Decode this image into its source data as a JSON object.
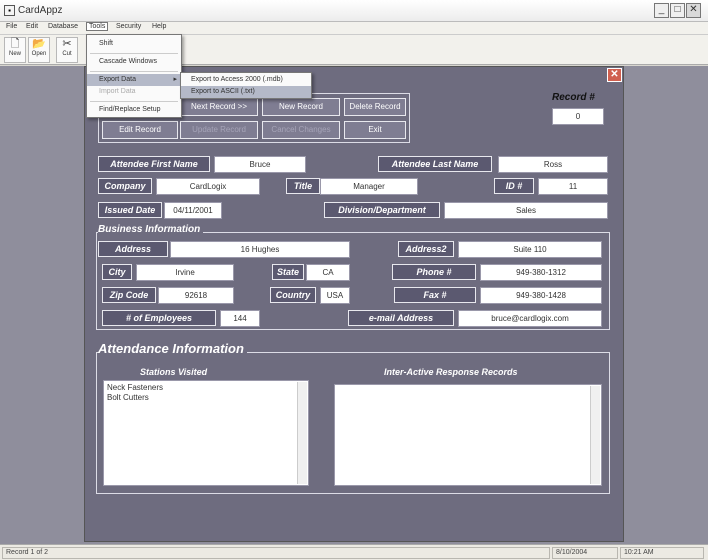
{
  "window": {
    "title": "CardAppz",
    "min": "_",
    "max": "□",
    "close": "✕"
  },
  "menubar": {
    "items": [
      "File",
      "Edit",
      "Database",
      "Tools",
      "Security",
      "Help"
    ]
  },
  "toolbar": {
    "new_label": "New",
    "new_icon": "new-document-icon",
    "open_label": "Open",
    "open_icon": "open-folder-icon",
    "cut_label": "Cut",
    "cut_icon": "scissors-icon"
  },
  "tools_menu": {
    "items": [
      "Shift",
      "Cascade Windows",
      "Export Data",
      "Import Data",
      "Find/Replace Setup"
    ],
    "export_submenu": [
      "Export to Access 2000 (.mdb)",
      "Export to ASCII (.txt)"
    ],
    "submenu_arrow": "▸"
  },
  "form": {
    "close": "✕",
    "record_label": "Record #",
    "record_value": "0",
    "buttons": {
      "next": "Next Record >>",
      "new": "New Record",
      "delete": "Delete Record",
      "edit": "Edit Record",
      "disabled_1": "Update Record",
      "disabled_2": "Cancel Changes",
      "exit": "Exit"
    },
    "attendee_first_name_label": "Attendee First Name",
    "attendee_first_name": "Bruce",
    "attendee_last_name_label": "Attendee Last Name",
    "attendee_last_name": "Ross",
    "company_label": "Company",
    "company": "CardLogix",
    "title_label": "Title",
    "title": "Manager",
    "id_label": "ID #",
    "id": "11",
    "issued_date_label": "Issued Date",
    "issued_date": "04/11/2001",
    "division_label": "Division/Department",
    "division": "Sales",
    "business_section": "Business Information",
    "address_label": "Address",
    "address": "16 Hughes",
    "address2_label": "Address2",
    "address2": "Suite 110",
    "city_label": "City",
    "city": "Irvine",
    "state_label": "State",
    "state": "CA",
    "phone_label": "Phone #",
    "phone": "949-380-1312",
    "zip_label": "Zip Code",
    "zip": "92618",
    "country_label": "Country",
    "country": "USA",
    "fax_label": "Fax #",
    "fax": "949-380-1428",
    "employees_label": "# of Employees",
    "employees": "144",
    "email_label": "e-mail Address",
    "email": "bruce@cardlogix.com",
    "attendance_section": "Attendance Information",
    "stations_label": "Stations Visited",
    "stations": [
      "Neck Fasteners",
      "Bolt Cutters"
    ],
    "responses_label": "Inter-Active Response Records"
  },
  "status": {
    "record": "Record 1 of 2",
    "date": "8/10/2004",
    "time": "10:21 AM"
  }
}
